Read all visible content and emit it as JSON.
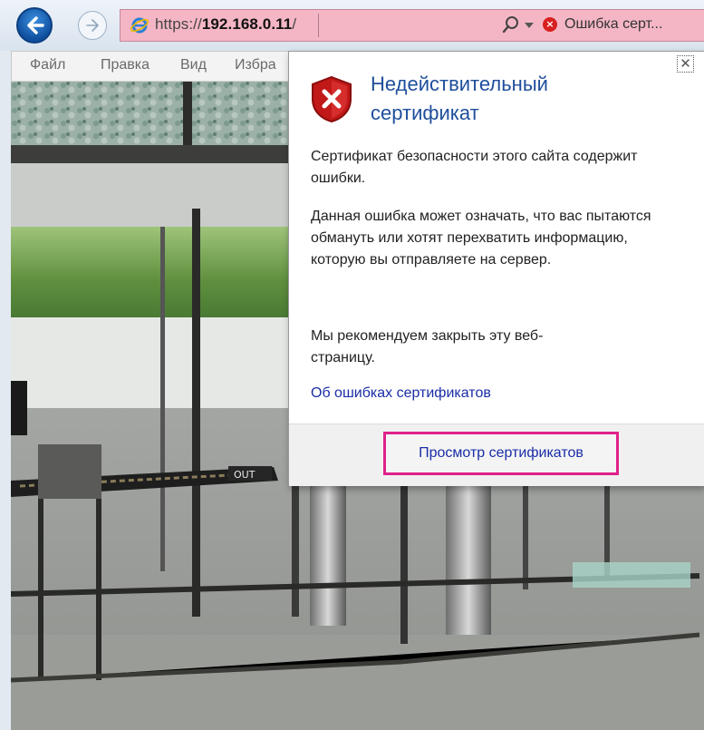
{
  "address_bar": {
    "url_scheme": "https://",
    "url_host": "192.168.0.11",
    "url_path": "/",
    "error_label": "Ошибка серт..."
  },
  "menu": {
    "items": [
      "Файл",
      "Правка",
      "Вид",
      "Избра"
    ]
  },
  "popup": {
    "title_line1": "Недействительный",
    "title_line2": "сертификат",
    "para1": "Сертификат безопасности этого сайта содержит ошибки.",
    "para2": "Данная ошибка может означать, что вас пытаются обмануть или хотят перехватить информацию, которую вы отправляете на сервер.",
    "para3": "Мы рекомендуем закрыть эту веб-страницу.",
    "link": "Об ошибках сертификатов",
    "button": "Просмотр сертификатов",
    "close_glyph": "✕"
  },
  "content": {
    "sign_text": "OUT"
  },
  "colors": {
    "url_error_bg": "#f4b6c5",
    "title_blue": "#1f4e9c",
    "link_blue": "#1a2da8",
    "highlight_magenta": "#e0218a"
  },
  "icons": {
    "back": "arrow-left-icon",
    "forward": "arrow-right-icon",
    "browser": "internet-explorer-icon",
    "search": "search-icon",
    "dropdown": "chevron-down-icon",
    "error": "error-x-icon",
    "shield": "shield-error-icon",
    "close": "close-icon"
  }
}
